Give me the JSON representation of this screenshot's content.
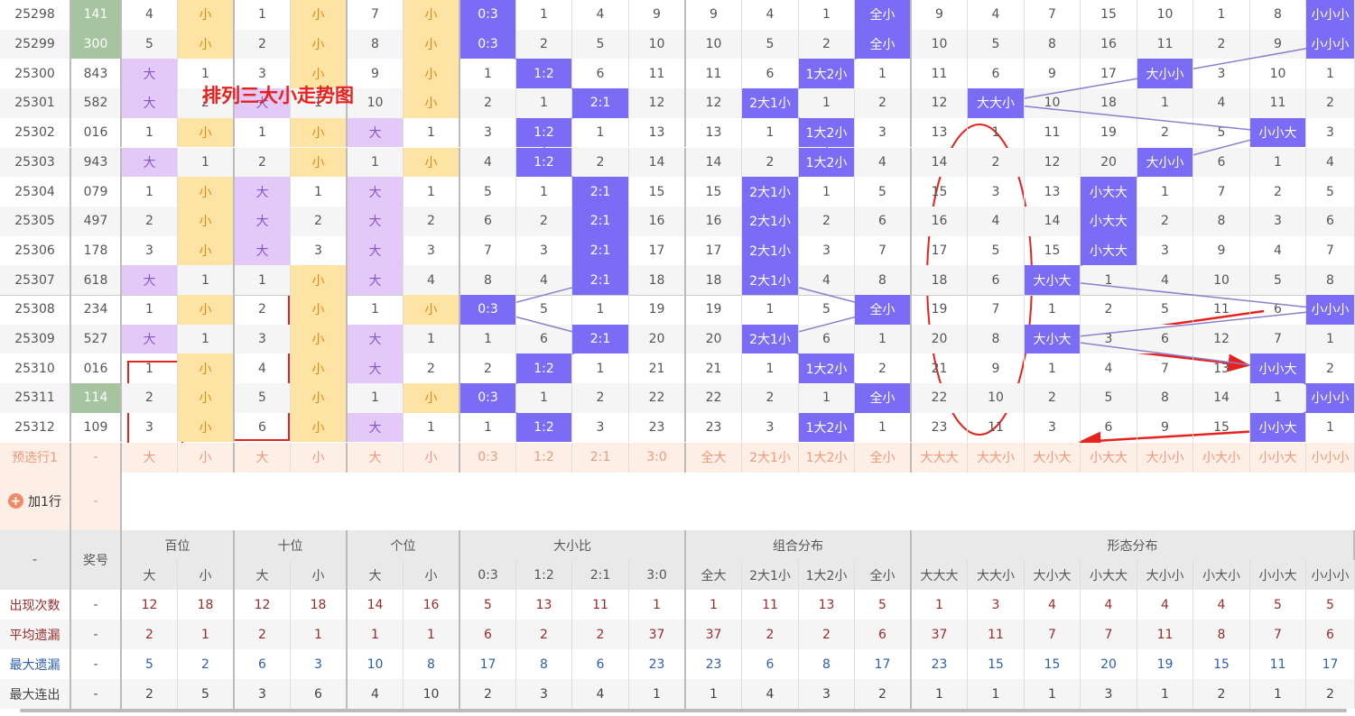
{
  "title_overlay": "排列三大小走势图",
  "colors": {
    "big_hit": "#e2c9f7",
    "small_hit": "#fde3a4",
    "pattern_hit": "#7b6cf6",
    "trend_line": "#8a80d0",
    "annotation": "#e8211d",
    "repeat_number": "#a6c4a0"
  },
  "rows": [
    {
      "period": "25298",
      "number": "141",
      "hl": true,
      "cells": [
        "4",
        "小",
        "1",
        "小",
        "7",
        "小",
        "0:3",
        "1",
        "4",
        "9",
        "9",
        "4",
        "1",
        "全小",
        "9",
        "4",
        "7",
        "15",
        "10",
        "1",
        "8",
        "小小小"
      ]
    },
    {
      "period": "25299",
      "number": "300",
      "hl": true,
      "cells": [
        "5",
        "小",
        "2",
        "小",
        "8",
        "小",
        "0:3",
        "2",
        "5",
        "10",
        "10",
        "5",
        "2",
        "全小",
        "10",
        "5",
        "8",
        "16",
        "11",
        "2",
        "9",
        "小小小"
      ]
    },
    {
      "period": "25300",
      "number": "843",
      "cells": [
        "大",
        "1",
        "3",
        "小",
        "9",
        "小",
        "1",
        "1:2",
        "6",
        "11",
        "11",
        "6",
        "1大2小",
        "1",
        "11",
        "6",
        "9",
        "17",
        "大小小",
        "3",
        "10",
        "1"
      ]
    },
    {
      "period": "25301",
      "number": "582",
      "cells": [
        "大",
        "2",
        "大",
        "1",
        "10",
        "小",
        "2",
        "1",
        "2:1",
        "12",
        "12",
        "2大1小",
        "1",
        "2",
        "12",
        "大大小",
        "10",
        "18",
        "1",
        "4",
        "11",
        "2"
      ]
    },
    {
      "period": "25302",
      "number": "016",
      "cells": [
        "1",
        "小",
        "1",
        "小",
        "大",
        "1",
        "3",
        "1:2",
        "1",
        "13",
        "13",
        "1",
        "1大2小",
        "3",
        "13",
        "1",
        "11",
        "19",
        "2",
        "5",
        "小小大",
        "3"
      ]
    },
    {
      "period": "25303",
      "number": "943",
      "cells": [
        "大",
        "1",
        "2",
        "小",
        "1",
        "小",
        "4",
        "1:2",
        "2",
        "14",
        "14",
        "2",
        "1大2小",
        "4",
        "14",
        "2",
        "12",
        "20",
        "大小小",
        "6",
        "1",
        "4"
      ]
    },
    {
      "period": "25304",
      "number": "079",
      "cells": [
        "1",
        "小",
        "大",
        "1",
        "大",
        "1",
        "5",
        "1",
        "2:1",
        "15",
        "15",
        "2大1小",
        "1",
        "5",
        "15",
        "3",
        "13",
        "小大大",
        "1",
        "7",
        "2",
        "5"
      ]
    },
    {
      "period": "25305",
      "number": "497",
      "cells": [
        "2",
        "小",
        "大",
        "2",
        "大",
        "2",
        "6",
        "2",
        "2:1",
        "16",
        "16",
        "2大1小",
        "2",
        "6",
        "16",
        "4",
        "14",
        "小大大",
        "2",
        "8",
        "3",
        "6"
      ]
    },
    {
      "period": "25306",
      "number": "178",
      "cells": [
        "3",
        "小",
        "大",
        "3",
        "大",
        "3",
        "7",
        "3",
        "2:1",
        "17",
        "17",
        "2大1小",
        "3",
        "7",
        "17",
        "5",
        "15",
        "小大大",
        "3",
        "9",
        "4",
        "7"
      ]
    },
    {
      "period": "25307",
      "number": "618",
      "cells": [
        "大",
        "1",
        "1",
        "小",
        "大",
        "4",
        "8",
        "4",
        "2:1",
        "18",
        "18",
        "2大1小",
        "4",
        "8",
        "18",
        "6",
        "大小大",
        "1",
        "4",
        "10",
        "5",
        "8"
      ]
    },
    {
      "period": "25308",
      "number": "234",
      "cells": [
        "1",
        "小",
        "2",
        "小",
        "1",
        "小",
        "0:3",
        "5",
        "1",
        "19",
        "19",
        "1",
        "5",
        "全小",
        "19",
        "7",
        "1",
        "2",
        "5",
        "11",
        "6",
        "小小小"
      ]
    },
    {
      "period": "25309",
      "number": "527",
      "cells": [
        "大",
        "1",
        "3",
        "小",
        "大",
        "1",
        "1",
        "6",
        "2:1",
        "20",
        "20",
        "2大1小",
        "6",
        "1",
        "20",
        "8",
        "大小大",
        "3",
        "6",
        "12",
        "7",
        "1"
      ]
    },
    {
      "period": "25310",
      "number": "016",
      "cells": [
        "1",
        "小",
        "4",
        "小",
        "大",
        "2",
        "2",
        "1:2",
        "1",
        "21",
        "21",
        "1",
        "1大2小",
        "2",
        "21",
        "9",
        "1",
        "4",
        "7",
        "13",
        "小小大",
        "2"
      ]
    },
    {
      "period": "25311",
      "number": "114",
      "hl": true,
      "cells": [
        "2",
        "小",
        "5",
        "小",
        "1",
        "小",
        "0:3",
        "1",
        "2",
        "22",
        "22",
        "2",
        "1",
        "全小",
        "22",
        "10",
        "2",
        "5",
        "8",
        "14",
        "1",
        "小小小"
      ]
    },
    {
      "period": "25312",
      "number": "109",
      "cells": [
        "3",
        "小",
        "6",
        "小",
        "大",
        "1",
        "1",
        "1:2",
        "3",
        "23",
        "23",
        "3",
        "1大2小",
        "1",
        "23",
        "11",
        "3",
        "6",
        "9",
        "15",
        "小小大",
        "1"
      ]
    }
  ],
  "preselect": {
    "label": "预选行1",
    "number": "-",
    "cells": [
      "大",
      "小",
      "大",
      "小",
      "大",
      "小",
      "0:3",
      "1:2",
      "2:1",
      "3:0",
      "全大",
      "2大1小",
      "1大2小",
      "全小",
      "大大大",
      "大大小",
      "大小大",
      "小大大",
      "大小小",
      "小大小",
      "小小大",
      "小小小"
    ]
  },
  "add_row": {
    "label": "加1行",
    "number": "-"
  },
  "header": {
    "corner": "-",
    "number": "奖号",
    "groups": [
      "百位",
      "十位",
      "个位",
      "大小比",
      "组合分布",
      "形态分布"
    ],
    "subs": [
      "大",
      "小",
      "大",
      "小",
      "大",
      "小",
      "0:3",
      "1:2",
      "2:1",
      "3:0",
      "全大",
      "2大1小",
      "1大2小",
      "全小",
      "大大大",
      "大大小",
      "大小大",
      "小大大",
      "大小小",
      "小大小",
      "小小大",
      "小小小"
    ]
  },
  "stats": [
    {
      "label": "出现次数",
      "number": "-",
      "values": [
        "12",
        "18",
        "12",
        "18",
        "14",
        "16",
        "5",
        "13",
        "11",
        "1",
        "1",
        "11",
        "13",
        "5",
        "1",
        "3",
        "4",
        "4",
        "4",
        "4",
        "5",
        "5"
      ]
    },
    {
      "label": "平均遗漏",
      "number": "-",
      "values": [
        "2",
        "1",
        "2",
        "1",
        "1",
        "1",
        "6",
        "2",
        "2",
        "37",
        "37",
        "2",
        "2",
        "6",
        "37",
        "11",
        "7",
        "7",
        "11",
        "8",
        "7",
        "6"
      ]
    },
    {
      "label": "最大遗漏",
      "number": "-",
      "values": [
        "5",
        "2",
        "6",
        "3",
        "10",
        "8",
        "17",
        "8",
        "6",
        "23",
        "23",
        "6",
        "8",
        "17",
        "23",
        "15",
        "15",
        "20",
        "19",
        "15",
        "11",
        "17"
      ]
    },
    {
      "label": "最大连出",
      "number": "-",
      "values": [
        "2",
        "5",
        "3",
        "6",
        "4",
        "10",
        "2",
        "3",
        "4",
        "1",
        "1",
        "4",
        "3",
        "2",
        "1",
        "1",
        "1",
        "3",
        "1",
        "2",
        "1",
        "2"
      ]
    }
  ]
}
